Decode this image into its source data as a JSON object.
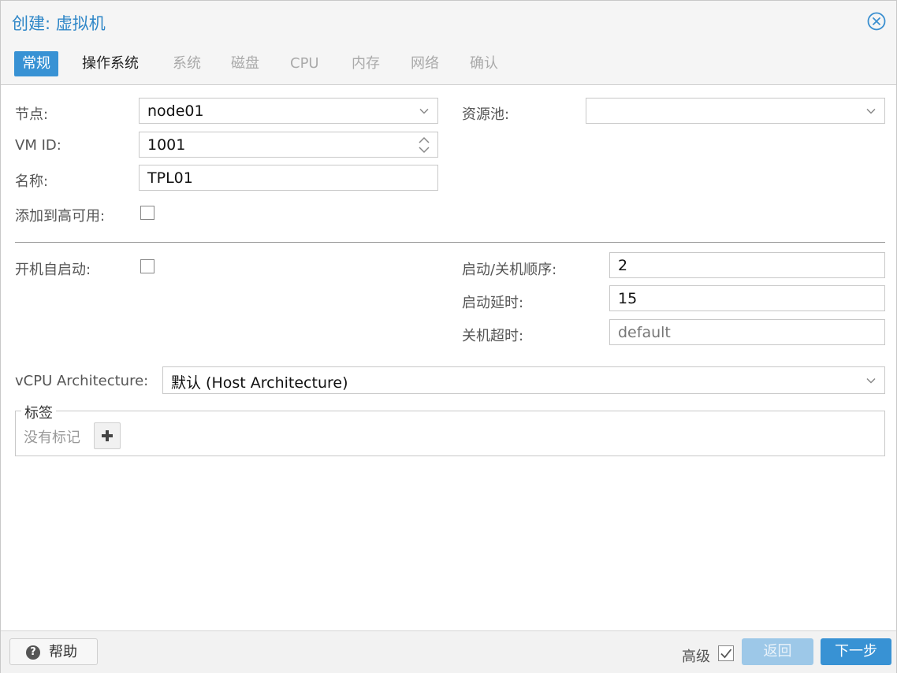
{
  "dialog": {
    "title": "创建: 虚拟机"
  },
  "tabs": [
    {
      "label": "常规",
      "state": "active"
    },
    {
      "label": "操作系统",
      "state": "enabled"
    },
    {
      "label": "系统",
      "state": "disabled"
    },
    {
      "label": "磁盘",
      "state": "disabled"
    },
    {
      "label": "CPU",
      "state": "disabled"
    },
    {
      "label": "内存",
      "state": "disabled"
    },
    {
      "label": "网络",
      "state": "disabled"
    },
    {
      "label": "确认",
      "state": "disabled"
    }
  ],
  "form": {
    "node": {
      "label": "节点:",
      "value": "node01"
    },
    "pool": {
      "label": "资源池:",
      "value": ""
    },
    "vmid": {
      "label": "VM ID:",
      "value": "1001"
    },
    "name": {
      "label": "名称:",
      "value": "TPL01"
    },
    "ha": {
      "label": "添加到高可用:",
      "checked": false
    },
    "onboot": {
      "label": "开机自启动:",
      "checked": false
    },
    "startup_order": {
      "label": "启动/关机顺序:",
      "value": "2"
    },
    "startup_delay": {
      "label": "启动延时:",
      "value": "15"
    },
    "shutdown_timeout": {
      "label": "关机超时:",
      "placeholder": "default"
    },
    "vcpu_arch": {
      "label": "vCPU Architecture:",
      "value": "默认 (Host Architecture)"
    },
    "tags": {
      "legend": "标签",
      "empty_text": "没有标记"
    }
  },
  "footer": {
    "help_label": "帮助",
    "advanced_label": "高级",
    "advanced_checked": true,
    "back_label": "返回",
    "next_label": "下一步"
  },
  "colors": {
    "accent": "#3892d4",
    "title": "#2f87c8",
    "disabled_button": "#9dc8e8"
  },
  "icons": {
    "close": "close-circle-icon",
    "help": "question-circle-icon",
    "add": "plus-icon"
  }
}
